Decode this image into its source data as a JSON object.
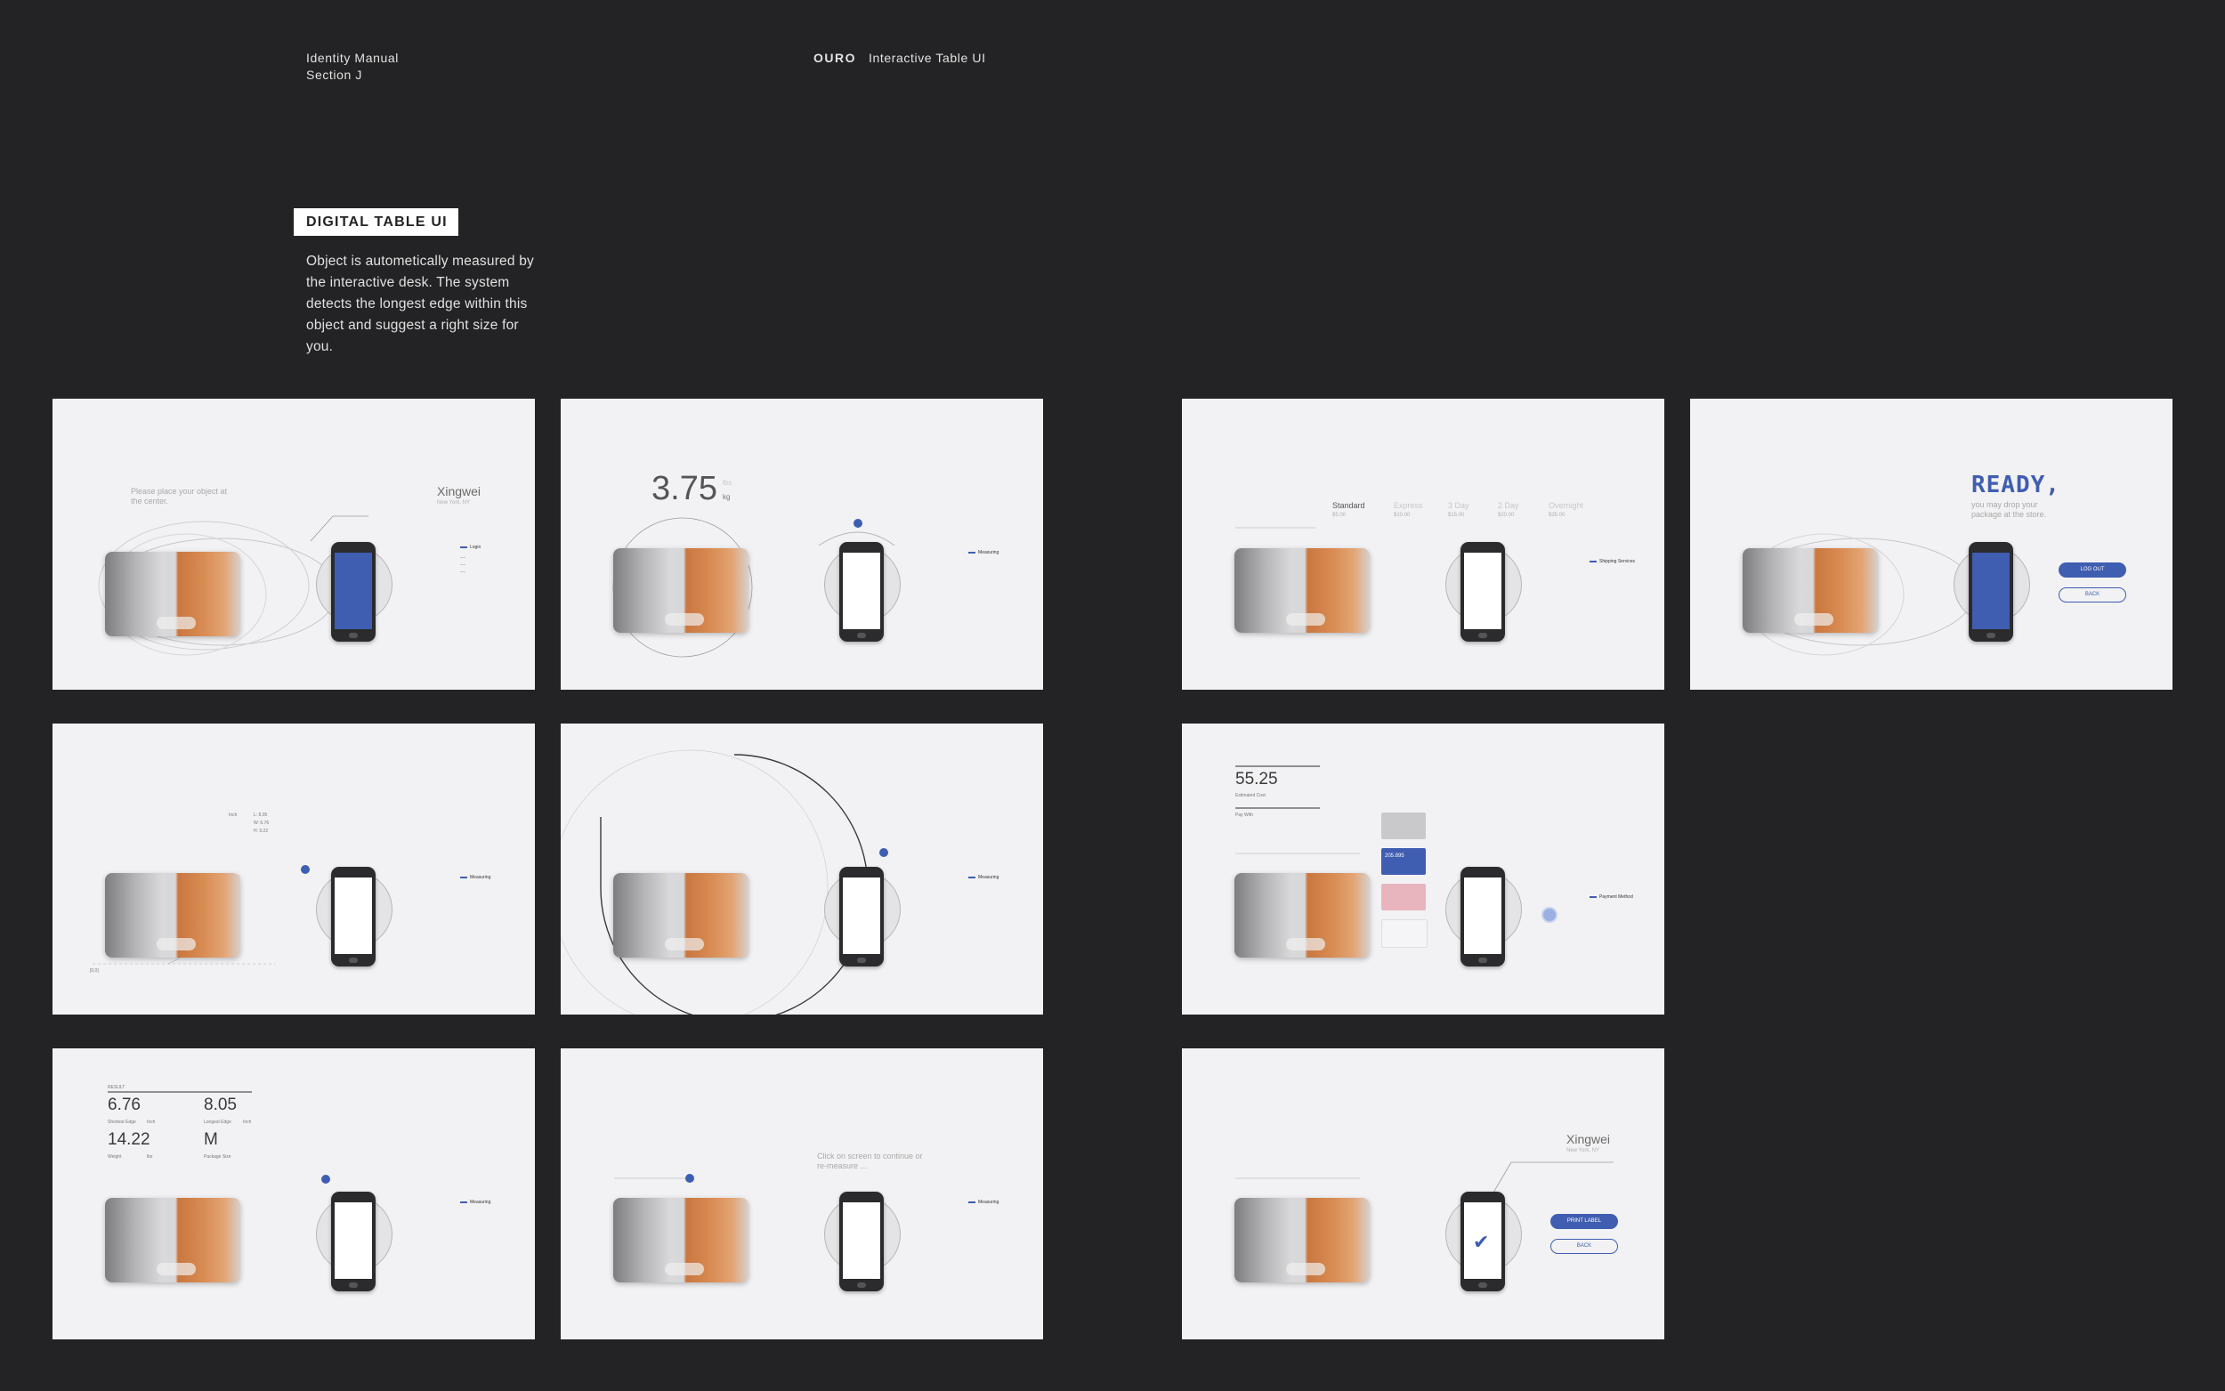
{
  "header": {
    "manual": "Identity Manual",
    "section": "Section J",
    "brand": "OURO",
    "subtitle": "Interactive Table UI"
  },
  "intro": {
    "tag": "DIGITAL TABLE UI",
    "description": "Object is autometically measured by the interactive desk. The system detects the longest edge within this object and suggest a right size for you."
  },
  "screens": {
    "place": {
      "prompt": "Please place your object at the center.",
      "user_name": "Xingwei",
      "user_location": "New York, NY",
      "menu_item": "Login"
    },
    "weight": {
      "value": "3.75",
      "unit": "kg",
      "unit_alt": "lbs",
      "menu_item": "Measuring"
    },
    "shipping": {
      "options": [
        {
          "name": "Standard",
          "price": "$5.00"
        },
        {
          "name": "Express",
          "price": "$10.00"
        },
        {
          "name": "3 Day",
          "price": "$15.00"
        },
        {
          "name": "2 Day",
          "price": "$20.00"
        },
        {
          "name": "Overnight",
          "price": "$35.00"
        }
      ],
      "menu_item": "Shipping Services"
    },
    "ready": {
      "title": "READY,",
      "message": "you may drop your package at the store.",
      "logout_label": "LOG OUT",
      "back_label": "BACK"
    },
    "dimensions": {
      "unit": "Inch",
      "l": "L: 8.05",
      "w": "W: 6.76",
      "h": "H: 9.22",
      "origin": "[0,0]",
      "menu_item": "Measuring"
    },
    "scan": {
      "menu_item": "Measuring"
    },
    "payment": {
      "total": "55.25",
      "total_label": "Estimated Cost",
      "pay_label": "Pay With",
      "card_number": "205.895",
      "menu_item": "Payment Method"
    },
    "result": {
      "label": "RESULT",
      "shortest": "6.76",
      "shortest_label": "Shortest Edge",
      "shortest_unit": "Inch",
      "longest": "8.05",
      "longest_label": "Longest Edge",
      "longest_unit": "Inch",
      "weight": "14.22",
      "weight_label": "Weight",
      "weight_unit": "lbs",
      "size": "M",
      "size_label": "Package Size",
      "menu_item": "Measuring"
    },
    "confirm": {
      "prompt": "Click on screen to continue or re-measure ...",
      "menu_item": "Measuring"
    },
    "done": {
      "user_name": "Xingwei",
      "user_location": "New York, NY",
      "print_label": "PRINT LABEL",
      "back_label": "BACK"
    }
  },
  "colors": {
    "background": "#232325",
    "panel": "#f2f2f4",
    "accent": "#3f5db1",
    "object_orange": "#d88b52"
  }
}
